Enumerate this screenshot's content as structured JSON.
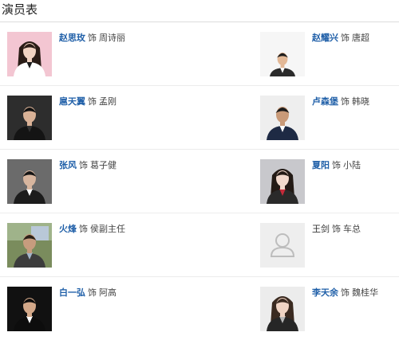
{
  "header": {
    "title": "演员表"
  },
  "cast": [
    {
      "left": {
        "actor": "赵思玫",
        "as": "饰",
        "role": "周诗丽",
        "linked": true,
        "portrait": "woman-pink"
      },
      "right": {
        "actor": "赵耀兴",
        "as": "饰",
        "role": "唐超",
        "linked": true,
        "portrait": "man-white"
      }
    },
    {
      "left": {
        "actor": "扈天翼",
        "as": "饰",
        "role": "孟刚",
        "linked": true,
        "portrait": "man-dark"
      },
      "right": {
        "actor": "卢森堡",
        "as": "饰",
        "role": "韩晓",
        "linked": true,
        "portrait": "man-smile"
      }
    },
    {
      "left": {
        "actor": "张风",
        "as": "饰",
        "role": "葛子健",
        "linked": true,
        "portrait": "man-suit"
      },
      "right": {
        "actor": "夏阳",
        "as": "饰",
        "role": "小陆",
        "linked": true,
        "portrait": "woman-grey"
      }
    },
    {
      "left": {
        "actor": "火烽",
        "as": "饰",
        "role": "侯副主任",
        "linked": true,
        "portrait": "outdoor"
      },
      "right": {
        "actor": "王剑",
        "as": "饰",
        "role": "车总",
        "linked": false,
        "portrait": "placeholder"
      }
    },
    {
      "left": {
        "actor": "白一弘",
        "as": "饰",
        "role": "阿高",
        "linked": true,
        "portrait": "man-black"
      },
      "right": {
        "actor": "李天余",
        "as": "饰",
        "role": "魏桂华",
        "linked": true,
        "portrait": "woman-light"
      }
    }
  ]
}
